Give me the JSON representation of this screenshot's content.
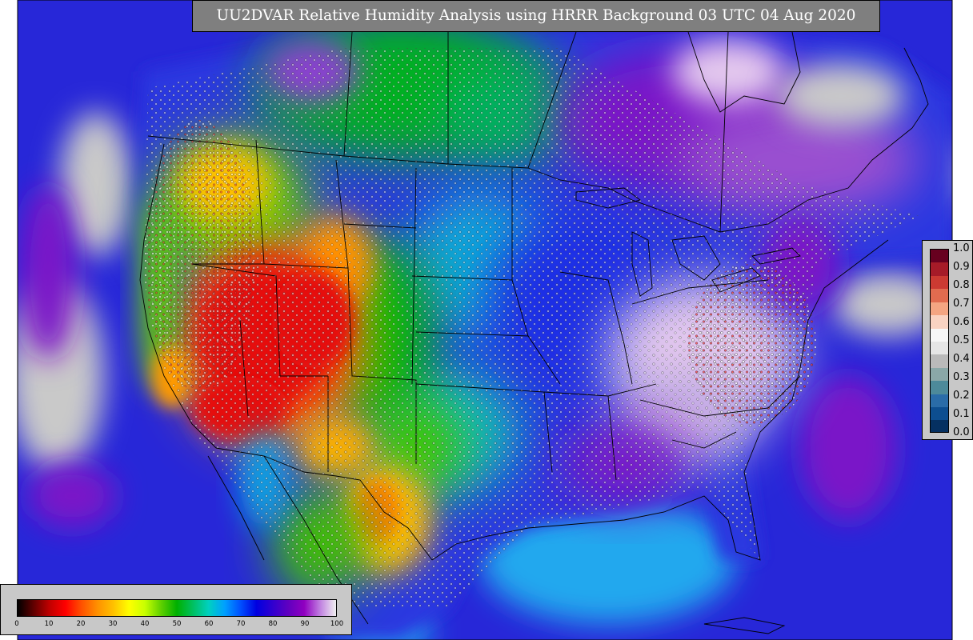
{
  "map": {
    "title": "UU2DVAR Relative Humidity Analysis using HRRR Background 03 UTC 04 Aug 2020",
    "colors": {
      "land_neutral": "#c9c9c9",
      "ocean": "#2727d8",
      "gulf": "#22a8ee",
      "dry_red": "#e61010",
      "orange": "#ff9a00",
      "yellow": "#ffe600",
      "green": "#00c000",
      "cyan": "#12a6ee",
      "blue": "#0a14e6",
      "purple": "#7a12c8",
      "lavender": "#e3c8ee"
    }
  },
  "legend_main": {
    "ticks": [
      "0",
      "10",
      "20",
      "30",
      "40",
      "50",
      "60",
      "70",
      "80",
      "90",
      "100"
    ],
    "colors": [
      "#000000",
      "#600000",
      "#c00000",
      "#ff0000",
      "#ff5000",
      "#ff9000",
      "#ffc000",
      "#ffff00",
      "#c8ff00",
      "#60d000",
      "#00b000",
      "#00c060",
      "#00d0c0",
      "#00a0ff",
      "#0050ff",
      "#0000e0",
      "#3000d0",
      "#6000c0",
      "#9000c0",
      "#c080e0",
      "#f0f0f0"
    ]
  },
  "legend_error": {
    "ticks": [
      "1.0",
      "0.9",
      "0.8",
      "0.7",
      "0.6",
      "0.5",
      "0.4",
      "0.3",
      "0.2",
      "0.1",
      "0.0"
    ],
    "colors": [
      "#67001f",
      "#a61b28",
      "#cc3a32",
      "#e16b4f",
      "#f4a582",
      "#f9d3c2",
      "#f7f7f7",
      "#e6e6e6",
      "#bababa",
      "#8aa8a8",
      "#4d8a9a",
      "#2a6ca8",
      "#0d4e90",
      "#053061"
    ]
  }
}
